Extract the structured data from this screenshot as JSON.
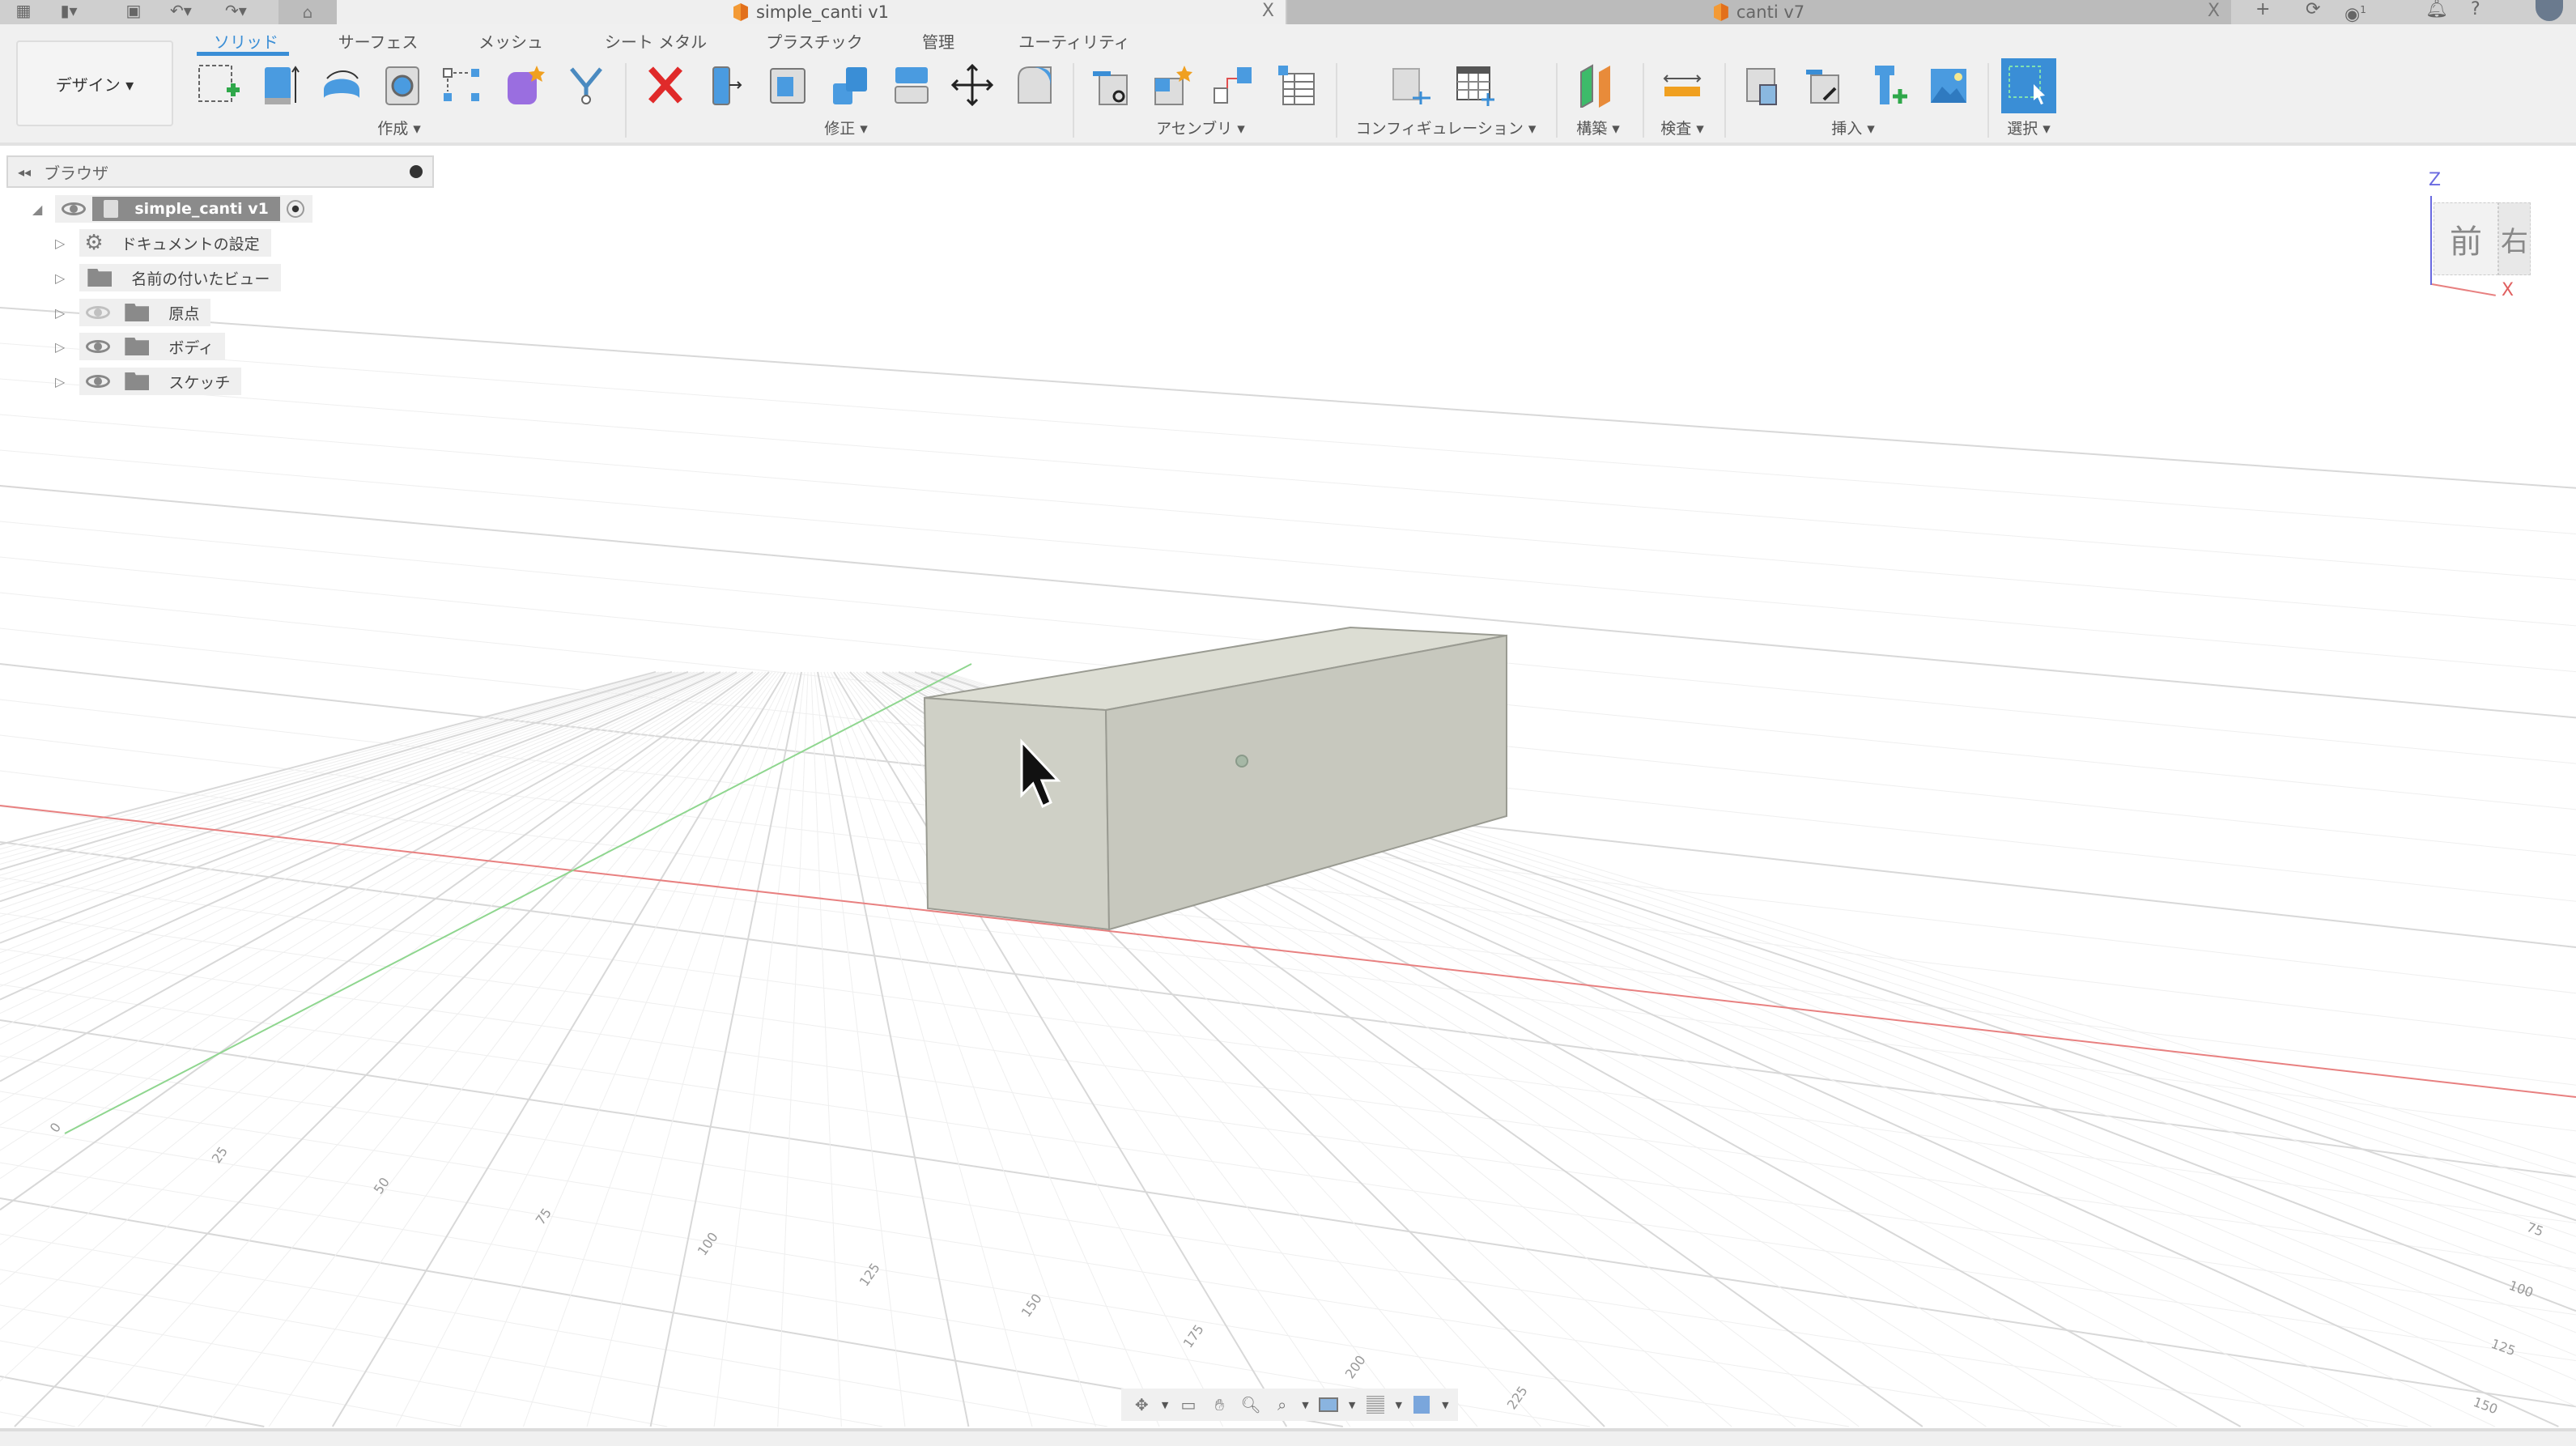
{
  "window": {
    "doc_tabs": [
      {
        "label": "simple_canti v1",
        "active": true
      },
      {
        "label": "canti v7",
        "active": false
      }
    ],
    "close_glyph": "X",
    "left_icons": [
      "apps-grid-icon",
      "file-icon",
      "save-icon",
      "undo-icon",
      "redo-icon",
      "home-icon"
    ],
    "right_icons": [
      "new-tab-icon",
      "sync-icon",
      "jobs-icon",
      "notification-icon",
      "help-icon",
      "avatar-icon"
    ],
    "jobs_count": "1"
  },
  "toolbar": {
    "workspace": "デザイン ▾",
    "tabs": [
      "ソリッド",
      "サーフェス",
      "メッシュ",
      "シート メタル",
      "プラスチック",
      "管理",
      "ユーティリティ"
    ],
    "active_tab": "ソリッド",
    "groups": [
      {
        "label": "作成 ▾",
        "icons": [
          "create-sketch-icon",
          "extrude-icon",
          "revolve-icon",
          "hole-icon",
          "pattern-icon",
          "form-icon",
          "split-body-icon"
        ]
      },
      {
        "label": "修正 ▾",
        "icons": [
          "delete-icon",
          "press-pull-icon",
          "shell-icon",
          "combine-icon",
          "offset-face-icon",
          "move-icon",
          "fillet-icon"
        ]
      },
      {
        "label": "アセンブリ ▾",
        "icons": [
          "joint-icon",
          "new-component-icon",
          "as-built-joint-icon",
          "bom-table-icon"
        ]
      },
      {
        "label": "コンフィギュレーション ▾",
        "icons": [
          "configure-icon",
          "configuration-table-icon"
        ]
      },
      {
        "label": "構築 ▾",
        "icons": [
          "offset-plane-icon"
        ]
      },
      {
        "label": "検査 ▾",
        "icons": [
          "measure-icon"
        ]
      },
      {
        "label": "挿入 ▾",
        "icons": [
          "insert-derive-icon",
          "insert-link-icon",
          "insert-fastener-icon",
          "insert-canvas-icon"
        ]
      },
      {
        "label": "選択 ▾",
        "icons": [
          "select-icon"
        ]
      }
    ]
  },
  "browser": {
    "title": "ブラウザ",
    "root": "simple_canti v1",
    "items": [
      {
        "label": "ドキュメントの設定",
        "icon": "gear-icon",
        "visible": null
      },
      {
        "label": "名前の付いたビュー",
        "icon": "folder-icon",
        "visible": null
      },
      {
        "label": "原点",
        "icon": "folder-icon",
        "visible": false
      },
      {
        "label": "ボディ",
        "icon": "folder-icon",
        "visible": true
      },
      {
        "label": "スケッチ",
        "icon": "folder-icon",
        "visible": true
      }
    ]
  },
  "viewcube": {
    "front": "前",
    "right": "右",
    "z": "Z",
    "x": "X"
  },
  "grid": {
    "left_ticks": [
      "0",
      "25",
      "50",
      "75",
      "100",
      "125",
      "150",
      "175",
      "200",
      "225"
    ],
    "right_ticks": [
      "75",
      "100",
      "125",
      "150"
    ]
  },
  "colors": {
    "accent": "#3a8ed6",
    "x_axis": "#e88080",
    "y_axis": "#8fd68f",
    "z_axis": "#6a6ae0",
    "body": "#cfd0c6"
  },
  "navbar": [
    "orbit-icon",
    "look-at-icon",
    "pan-icon",
    "zoom-icon",
    "fit-icon",
    "display-settings-icon",
    "grid-settings-icon",
    "viewports-icon"
  ]
}
